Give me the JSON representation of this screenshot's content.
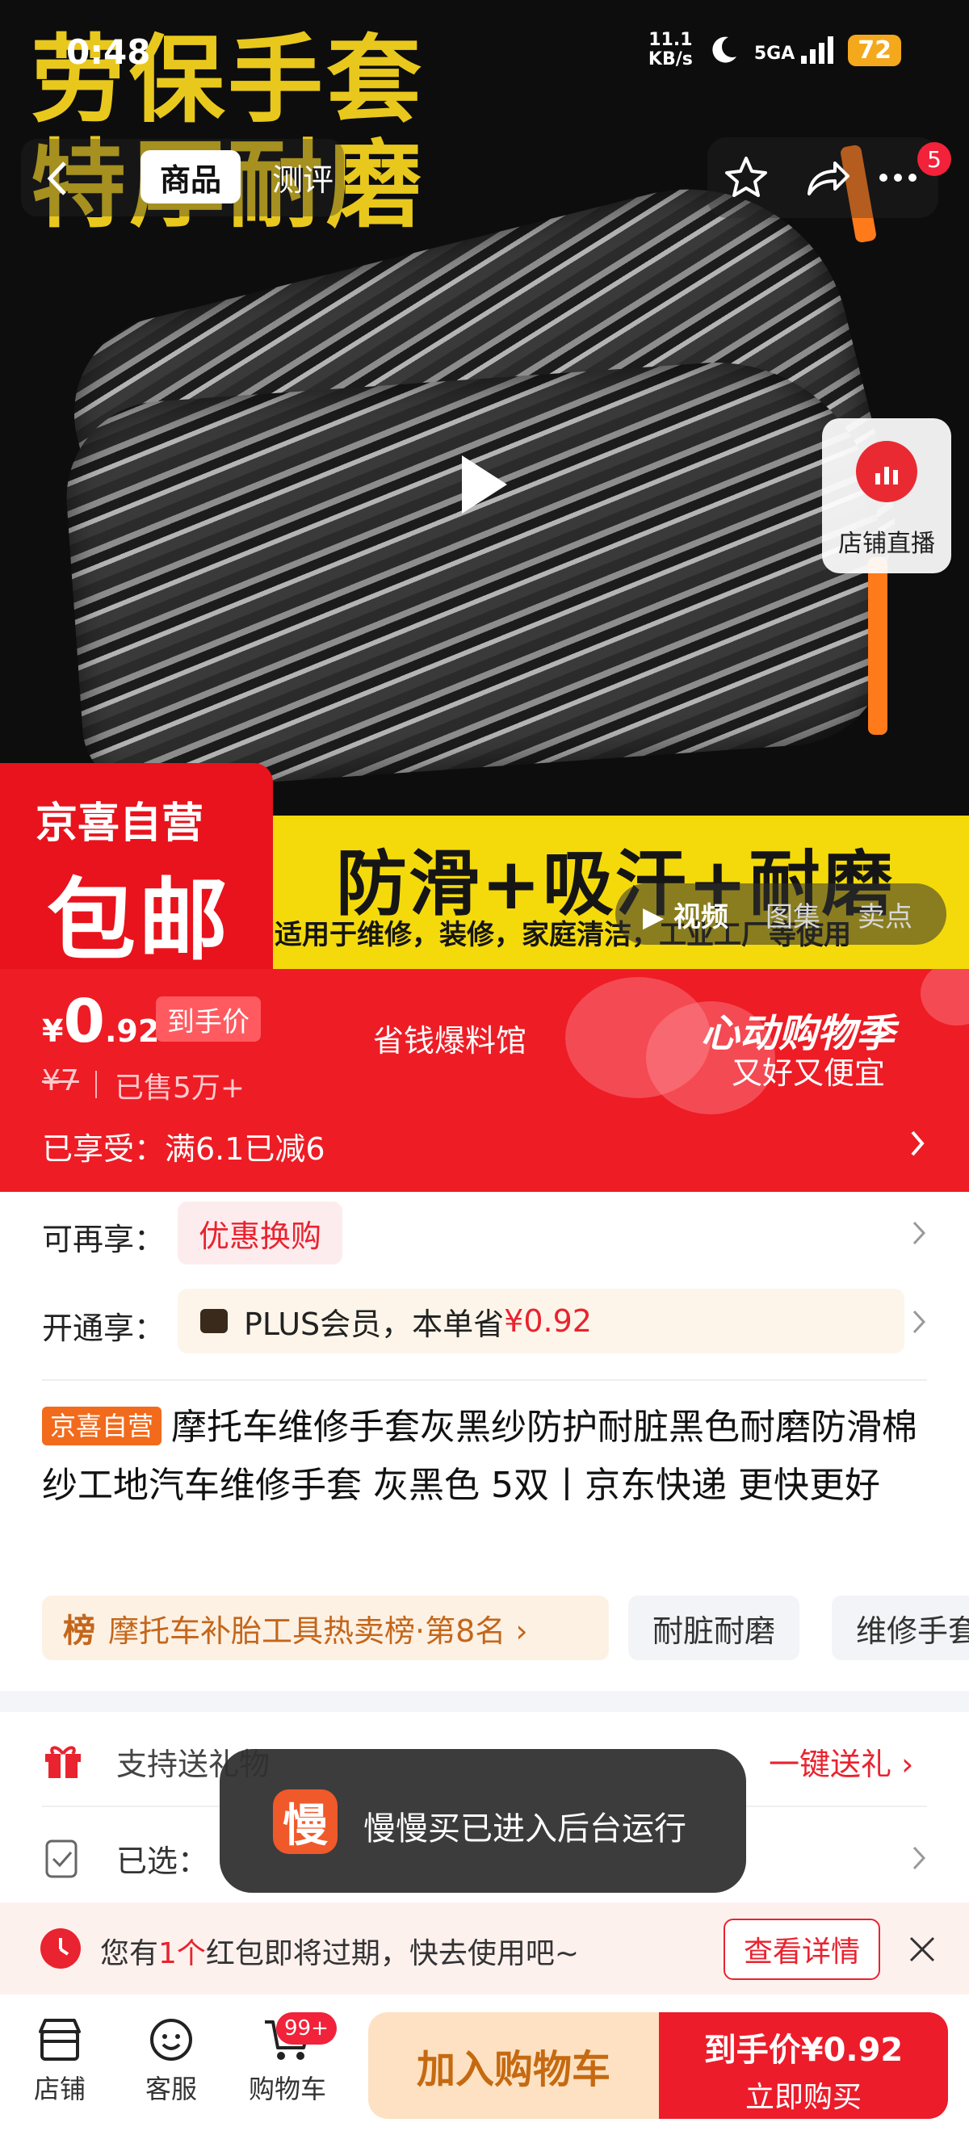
{
  "status_bar": {
    "time": "0:48",
    "speed_top": "11.1",
    "speed_bottom": "KB/s",
    "network": "5GA",
    "battery": "72"
  },
  "nav": {
    "tab_product": "商品",
    "tab_review": "测评",
    "message_count": "5"
  },
  "hero": {
    "title_line1": "劳保手套",
    "title_line2": "特厚耐磨",
    "strip_main": "防滑+吸汗+耐磨",
    "strip_sub": "适用于维修，装修，家庭清洁，工业工厂等使用",
    "badge_top": "京喜自营",
    "badge_big": "包邮",
    "media_tabs": [
      "视频",
      "图集",
      "卖点"
    ],
    "live_label": "店铺直播"
  },
  "price_band": {
    "currency": "¥",
    "price_int": "0",
    "price_dec": ".92",
    "hand_tag": "到手价",
    "old_price": "¥7",
    "sold": "已售5万+",
    "save_hall": "省钱爆料馆",
    "season": "心动购物季",
    "season_sub": "又好又便宜",
    "enjoyed": "已享受：满6.1已减6"
  },
  "promo": {
    "more_label": "可再享：",
    "more_tag": "优惠换购",
    "open_label": "开通享：",
    "plus_text": "PLUS会员，本单省",
    "plus_amount": "¥0.92"
  },
  "product": {
    "store_tag": "京喜自营",
    "title": "摩托车维修手套灰黑纱防护耐脏黑色耐磨防滑棉纱工地汽车维修手套 灰黑色 5双丨京东快递 更快更好",
    "rank_icon": "榜",
    "rank_text": "摩托车补胎工具热卖榜·第8名 ›",
    "chips": [
      "耐脏耐磨",
      "维修手套"
    ]
  },
  "service": {
    "gift_text": "支持送礼物",
    "gift_action": "一键送礼 ›",
    "selected_text": "已选："
  },
  "toast": {
    "icon": "慢",
    "text": "慢慢买已进入后台运行"
  },
  "notice": {
    "pre": "您有",
    "count": "1个",
    "post": "红包即将过期，快去使用吧~",
    "button": "查看详情"
  },
  "bottom_bar": {
    "store": "店铺",
    "service": "客服",
    "cart": "购物车",
    "cart_badge": "99+",
    "add_cart": "加入购物车",
    "buy_top": "到手价¥0.92",
    "buy_bottom": "立即购买"
  },
  "colors": {
    "accent_red": "#ee1c25",
    "hero_yellow": "#f4da0a",
    "orange_tag": "#f26a1c"
  }
}
